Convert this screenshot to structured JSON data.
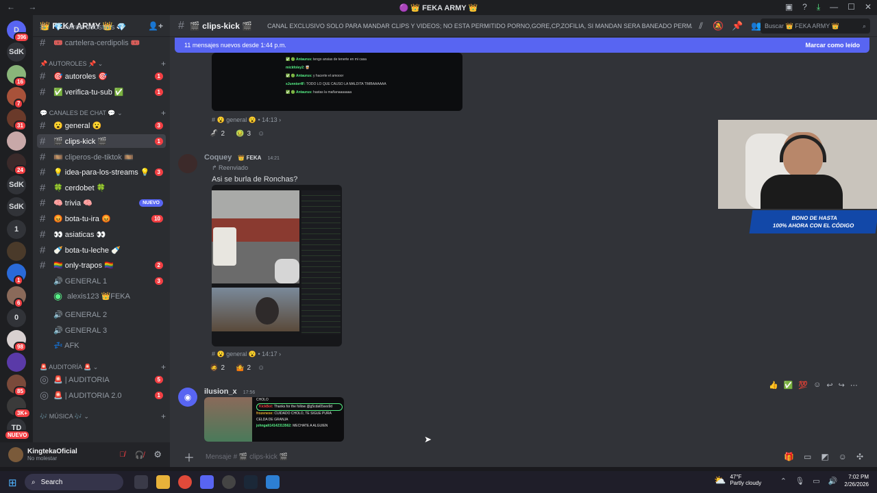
{
  "titlebar": {
    "title": "🟣 👑 FEKA ARMY 👑",
    "nav": "← →"
  },
  "guilds": [
    {
      "label": "D",
      "badge": "396"
    },
    {
      "label": "SdK",
      "badge": ""
    },
    {
      "label": "",
      "badge": "16"
    },
    {
      "label": "",
      "badge": "7"
    },
    {
      "label": "",
      "badge": "31"
    },
    {
      "label": "",
      "badge": ""
    },
    {
      "label": "",
      "badge": "24"
    },
    {
      "label": "SdK",
      "badge": ""
    },
    {
      "label": "SdK",
      "badge": ""
    },
    {
      "label": "1",
      "badge": ""
    },
    {
      "label": "",
      "badge": ""
    },
    {
      "label": "",
      "badge": "1"
    },
    {
      "label": "",
      "badge": "6"
    },
    {
      "label": "0",
      "badge": ""
    },
    {
      "label": "",
      "badge": "98"
    },
    {
      "label": "",
      "badge": ""
    },
    {
      "label": "",
      "badge": "85"
    },
    {
      "label": "",
      "badge": "3K+"
    },
    {
      "label": "TD",
      "badge": "NUEVO"
    }
  ],
  "sidebar": {
    "server_name": "👑 FEKA ARMY 👑 ⌄",
    "channels": [
      {
        "name": "💎 nitros-boosters 💎",
        "badge": "",
        "kind": "text",
        "state": ""
      },
      {
        "name": "🎟️ cartelera-cerdipolis 🎟️",
        "badge": "",
        "kind": "text",
        "state": ""
      },
      {
        "cat": "📌 AUTOROLES 📌 ⌄"
      },
      {
        "name": "🎯 autoroles 🎯",
        "badge": "1",
        "kind": "text",
        "state": "unread"
      },
      {
        "name": "✅ verifica-tu-sub ✅",
        "badge": "1",
        "kind": "text",
        "state": "unread"
      },
      {
        "cat": "💬 CANALES DE CHAT 💬 ⌄"
      },
      {
        "name": "😮 general 😮",
        "badge": "3",
        "kind": "text",
        "state": "unread"
      },
      {
        "name": "🎬 clips-kick 🎬",
        "badge": "1",
        "kind": "text",
        "state": "active"
      },
      {
        "name": "🎞️ cliperos-de-tiktok 🎞️",
        "badge": "",
        "kind": "text",
        "state": ""
      },
      {
        "name": "💡 idea-para-los-streams 💡",
        "badge": "3",
        "kind": "text",
        "state": "unread"
      },
      {
        "name": "🍀 cerdobet 🍀",
        "badge": "",
        "kind": "text",
        "state": "unread"
      },
      {
        "name": "🧠 trivia 🧠",
        "badge": "NUEVO",
        "kind": "text",
        "state": "unread"
      },
      {
        "name": "😡 bota-tu-ira 😡",
        "badge": "10",
        "kind": "text",
        "state": "unread"
      },
      {
        "name": "👀 asiaticas 👀",
        "badge": "",
        "kind": "text",
        "state": "unread"
      },
      {
        "name": "🍼 bota-tu-leche 🍼",
        "badge": "",
        "kind": "text",
        "state": "unread"
      },
      {
        "name": "🏳️‍🌈 only-trapos 🏳️‍🌈",
        "badge": "2",
        "kind": "text",
        "state": "unread"
      },
      {
        "name": "🔊 GENERAL 1",
        "badge": "3",
        "kind": "voice",
        "state": ""
      },
      {
        "name": "alexis123 👑FEKA",
        "badge": "",
        "kind": "member",
        "state": ""
      },
      {
        "name": "🔊 GENERAL 2",
        "badge": "",
        "kind": "voice",
        "state": ""
      },
      {
        "name": "🔊 GENERAL 3",
        "badge": "",
        "kind": "voice",
        "state": ""
      },
      {
        "name": "💤 AFK",
        "badge": "",
        "kind": "voice",
        "state": ""
      },
      {
        "cat": "🚨 AUDITORÍA 🚨 ⌄"
      },
      {
        "name": "🚨 | AUDITORIA",
        "badge": "5",
        "kind": "stage",
        "state": ""
      },
      {
        "name": "🚨 | AUDITORIA 2.0",
        "badge": "1",
        "kind": "stage",
        "state": ""
      },
      {
        "cat": "🎶 MÚSICA 🎶 ⌄"
      }
    ]
  },
  "user": {
    "name": "KingtekaOficial",
    "status": "No molestar"
  },
  "topbar": {
    "channel": "🎬 clips-kick 🎬",
    "topic": "CANAL EXCLUSIVO SOLO PARA MANDAR CLIPS Y VIDEOS; NO ESTA PERMITIDO PORNO,GORE,CP,ZOFILIA, SI MANDAN SERA BANEADO PERMA...",
    "search": "Buscar 👑 FEKA ARMY 👑"
  },
  "newbar": {
    "text": "11 mensajes nuevos desde 1:44 p.m.",
    "mark": "Marcar como leído"
  },
  "msg1": {
    "chat": [
      {
        "n": "✅ 🟢 Antaurus:",
        "t": "tengo ansias de tenerte en mi casa"
      },
      {
        "n": "mickfoley2:",
        "t": "🥃"
      },
      {
        "n": "✅ 🟢 Antaurus:",
        "t": "y hacerte el amooor"
      },
      {
        "n": "xJunnior4F:",
        "t": "TODO LO QUE CAUSO LA MALDITA TIMBAAAAAA"
      },
      {
        "n": "✅ 🟢 Antaurus:",
        "t": "hastas la mañanaaaaaaa"
      }
    ],
    "source": "# 😮 general 😮 • 14:13 ›",
    "reactions": [
      {
        "e": "🦨",
        "c": "2"
      },
      {
        "e": "🤢",
        "c": "3"
      }
    ]
  },
  "msg2": {
    "author": "Coquey",
    "tag": "👑 FEKA",
    "time": "14:21",
    "forwarded": "↱ Reenviado",
    "text": "Asi se burla de Ronchas?",
    "source": "# 😮 general 😮 • 14:17 ›",
    "reactions": [
      {
        "e": "🧔",
        "c": "2"
      },
      {
        "e": "🤷",
        "c": "2"
      }
    ]
  },
  "msg3": {
    "author": "ilusion_x",
    "time": "17:56",
    "preview": [
      {
        "n": "",
        "t": "CHOLO"
      },
      {
        "n": "KickBot:",
        "t": "Thanks for the follow @g5cda65xex9d"
      },
      {
        "n": "frozenexe:",
        "t": "CUIDADO CHOLO, TE SIGUE PURA CELDA DE GRANJA"
      },
      {
        "n": "johngalt14142313562:",
        "t": "MECHATE A ALGUIEN"
      }
    ]
  },
  "composer": {
    "placeholder": "Mensaje # 🎬 clips-kick 🎬"
  },
  "overlay": {
    "promo1": "BONO DE HASTA",
    "promo2": "100% AHORA CON EL CÓDIGO"
  },
  "taskbar": {
    "search": "Search",
    "weather_temp": "47°F",
    "weather_desc": "Partly cloudy",
    "time": "7:02 PM",
    "date": "2/26/2026"
  },
  "colors": {
    "accent": "#5865f2",
    "danger": "#f23f43",
    "bg": "#313338",
    "sidebar": "#2b2d31"
  }
}
